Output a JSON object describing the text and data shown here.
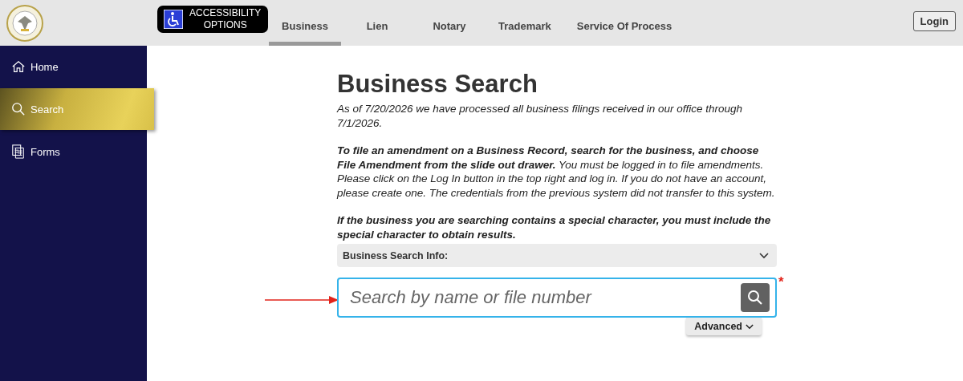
{
  "header": {
    "accessibility_button": [
      "ACCESSIBILITY",
      "OPTIONS"
    ],
    "tabs": [
      {
        "label": "Business",
        "selected": true
      },
      {
        "label": "Lien",
        "selected": false
      },
      {
        "label": "Notary",
        "selected": false
      },
      {
        "label": "Trademark",
        "selected": false
      },
      {
        "label": "Service Of Process",
        "selected": false
      }
    ],
    "login": "Login"
  },
  "sidebar": {
    "items": [
      {
        "kind": "home",
        "label": "Home",
        "selected": false
      },
      {
        "kind": "search",
        "label": "Search",
        "selected": true
      },
      {
        "kind": "forms",
        "label": "Forms",
        "selected": false
      }
    ]
  },
  "main": {
    "title": "Business Search",
    "paragraphs": [
      {
        "text": "As of 7/20/2026 we have processed all business filings received in our office through 7/1/2026.",
        "bold": false
      },
      {
        "text": "**To file an amendment on a Business Record, search for the business, and choose File Amendment from the slide out drawer.** You must be logged in to file amendments. Please click on the Log In button in the top right and log in. If you do not have an account, please create one. The credentials from the previous system did not transfer to this system.",
        "bold": false
      },
      {
        "text": "If the business you are searching contains a special character, you must include the special character to obtain results.",
        "bold": true
      }
    ],
    "info_panel": {
      "label": "Business Search Info:",
      "expanded": false
    },
    "search": {
      "placeholder": "Search by name or file number",
      "required_mark": "*"
    },
    "advanced": "Advanced"
  }
}
